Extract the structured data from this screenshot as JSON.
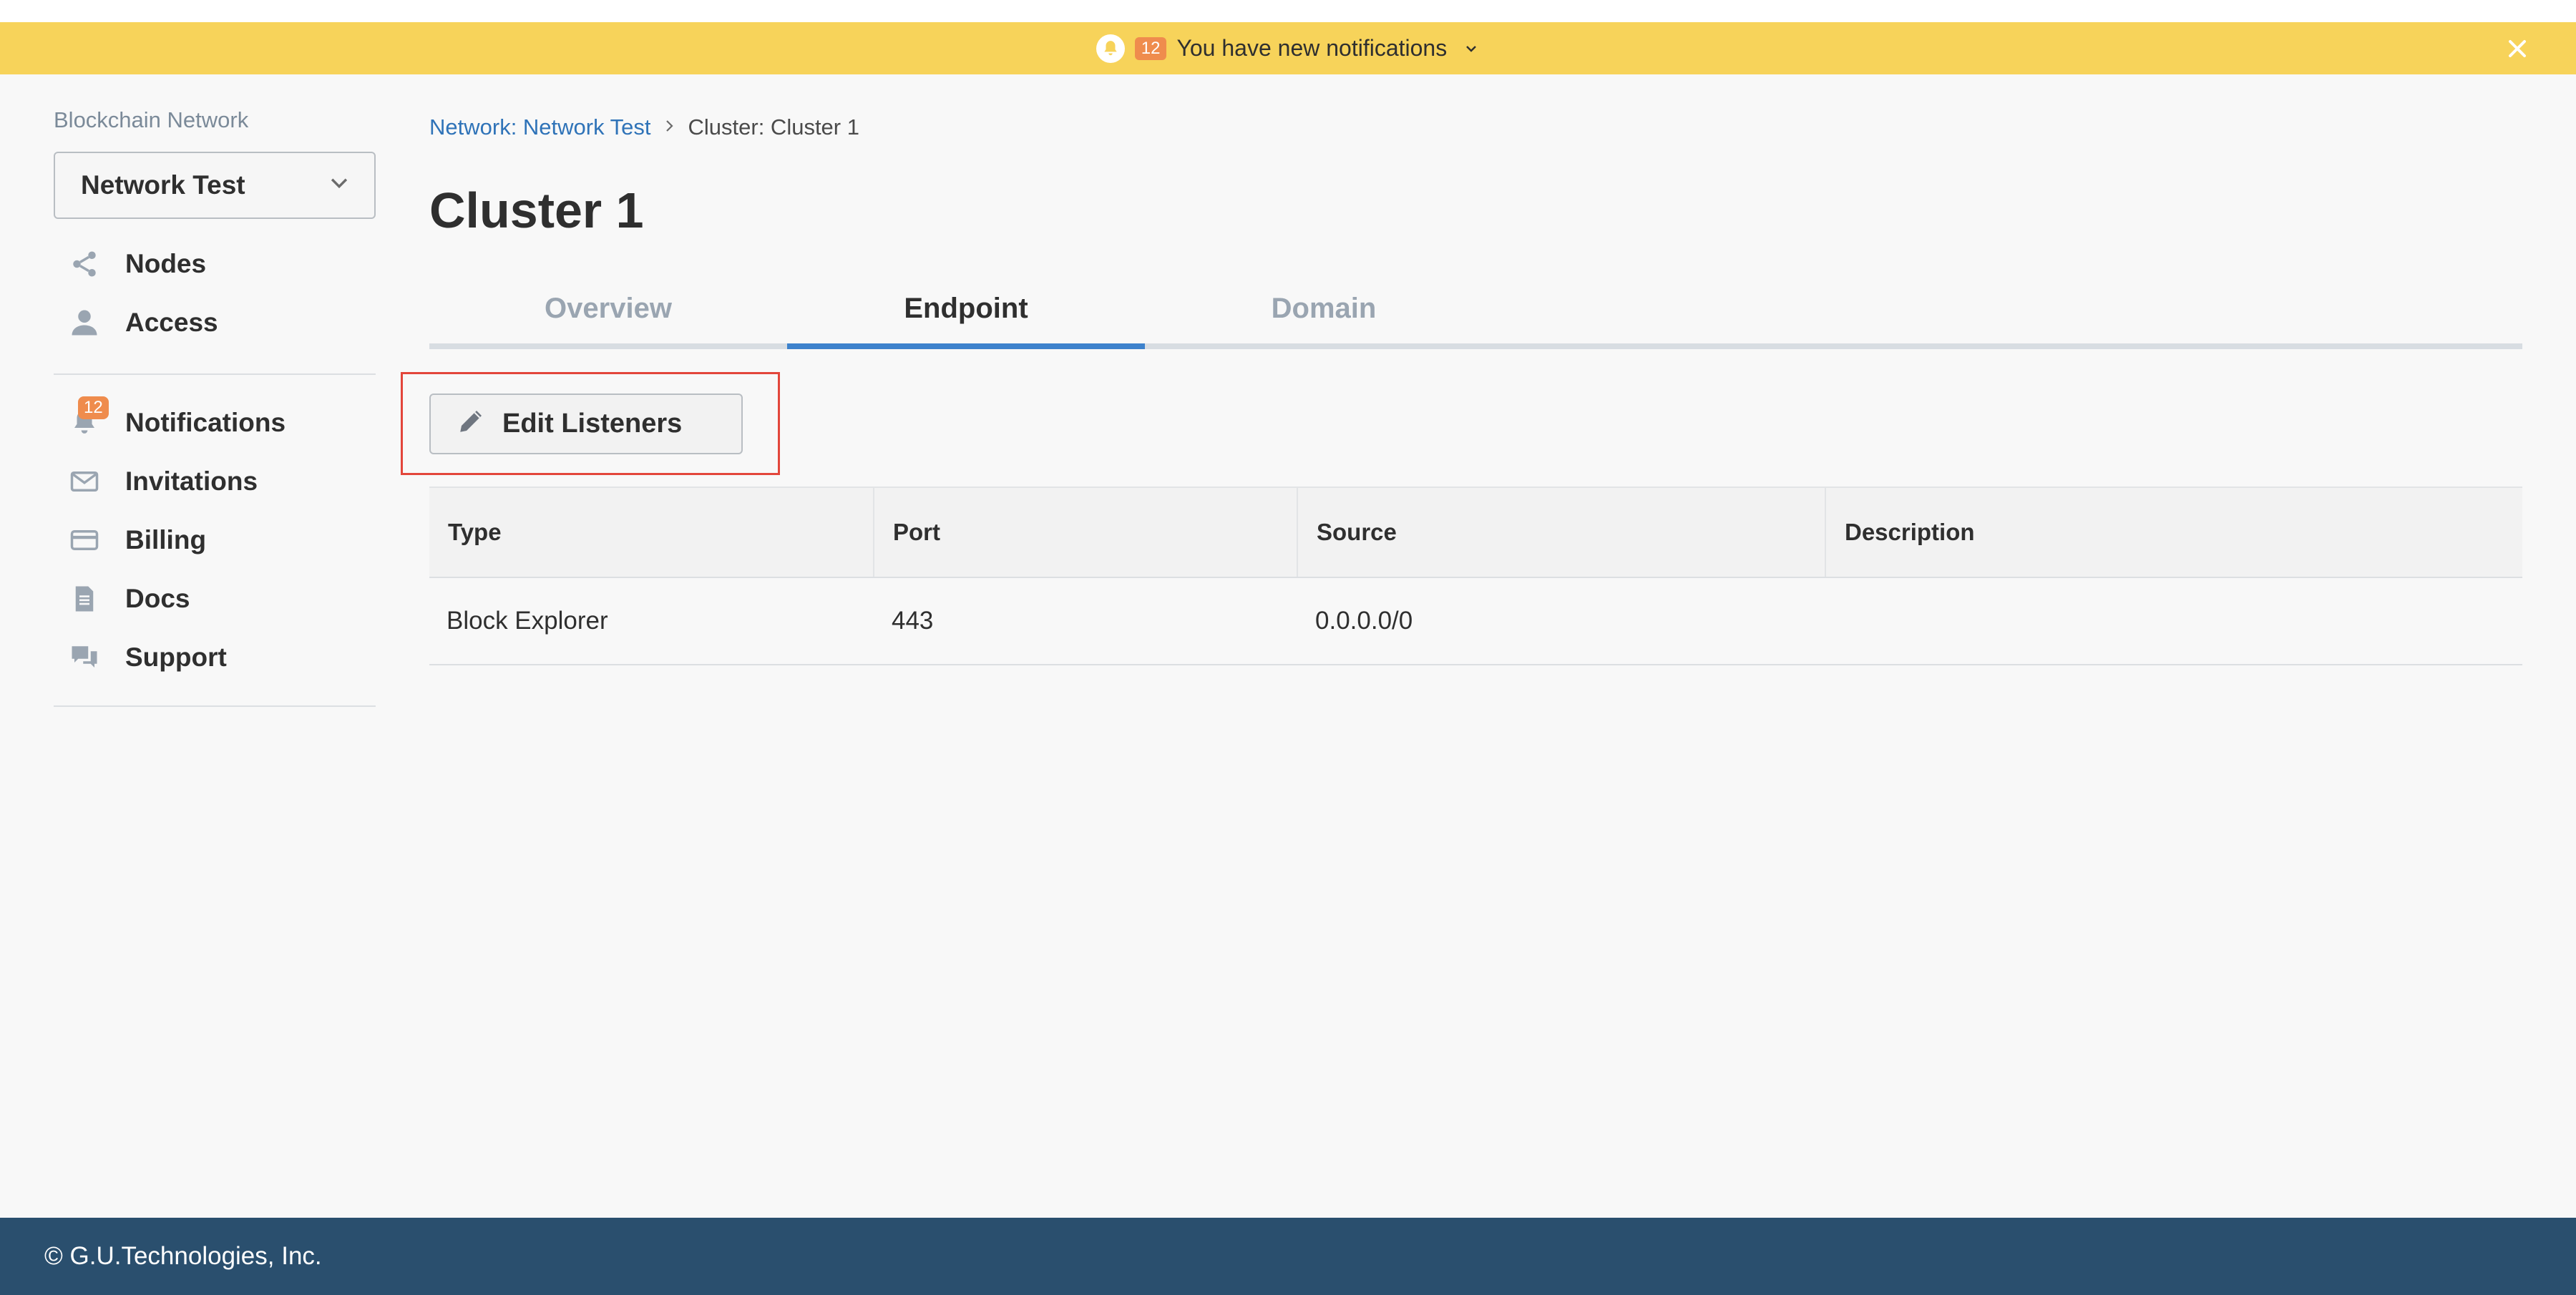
{
  "notification_bar": {
    "count": "12",
    "message": "You have new notifications",
    "color": "#f7d35a"
  },
  "sidebar": {
    "heading": "Blockchain Network",
    "network_select": "Network Test",
    "items_primary": [
      {
        "label": "Nodes",
        "icon": "share-icon"
      },
      {
        "label": "Access",
        "icon": "user-icon"
      }
    ],
    "items_secondary": [
      {
        "label": "Notifications",
        "icon": "bell-icon",
        "badge": "12"
      },
      {
        "label": "Invitations",
        "icon": "mail-icon"
      },
      {
        "label": "Billing",
        "icon": "credit-card-icon"
      },
      {
        "label": "Docs",
        "icon": "document-icon"
      },
      {
        "label": "Support",
        "icon": "chat-icon"
      }
    ]
  },
  "breadcrumb": {
    "network": "Network: Network Test",
    "cluster": "Cluster: Cluster 1"
  },
  "page": {
    "title": "Cluster 1"
  },
  "tabs": [
    {
      "label": "Overview",
      "active": false
    },
    {
      "label": "Endpoint",
      "active": true
    },
    {
      "label": "Domain",
      "active": false
    }
  ],
  "actions": {
    "edit_listeners": "Edit Listeners"
  },
  "table": {
    "headers": [
      "Type",
      "Port",
      "Source",
      "Description"
    ],
    "rows": [
      [
        "Block Explorer",
        "443",
        "0.0.0.0/0",
        ""
      ]
    ]
  },
  "footer": {
    "copyright": "© G.U.Technologies, Inc."
  },
  "colors": {
    "accent": "#3d82cc",
    "link": "#2f73b8",
    "badge": "#ef8c4d",
    "footer": "#2a4f6e"
  }
}
